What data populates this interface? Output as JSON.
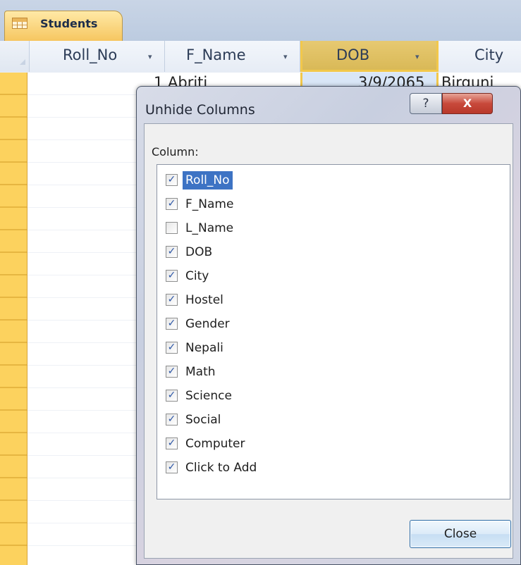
{
  "tab": {
    "label": "Students"
  },
  "datasheet": {
    "columns": [
      {
        "label": "Roll_No",
        "arrow": "▾"
      },
      {
        "label": "F_Name",
        "arrow": "▾"
      },
      {
        "label": "DOB",
        "arrow": "▾"
      },
      {
        "label": "City"
      }
    ],
    "first_row": {
      "roll_no": "1",
      "f_name": "Abriti",
      "dob": "3/9/2065",
      "city": "Birguni"
    },
    "colors": {
      "selector": "#fcd25e",
      "selected_column": "#d9e6f7",
      "accent": "#f2c84b"
    }
  },
  "dialog": {
    "title": "Unhide Columns",
    "help_glyph": "?",
    "close_glyph": "X",
    "column_label": "Column:",
    "items": [
      {
        "label": "Roll_No",
        "checked": true,
        "selected": true
      },
      {
        "label": "F_Name",
        "checked": true,
        "selected": false
      },
      {
        "label": "L_Name",
        "checked": false,
        "selected": false
      },
      {
        "label": "DOB",
        "checked": true,
        "selected": false
      },
      {
        "label": "City",
        "checked": true,
        "selected": false
      },
      {
        "label": "Hostel",
        "checked": true,
        "selected": false
      },
      {
        "label": "Gender",
        "checked": true,
        "selected": false
      },
      {
        "label": "Nepali",
        "checked": true,
        "selected": false
      },
      {
        "label": "Math",
        "checked": true,
        "selected": false
      },
      {
        "label": "Science",
        "checked": true,
        "selected": false
      },
      {
        "label": "Social",
        "checked": true,
        "selected": false
      },
      {
        "label": "Computer",
        "checked": true,
        "selected": false
      },
      {
        "label": "Click to Add",
        "checked": true,
        "selected": false
      }
    ],
    "close_button": "Close"
  }
}
